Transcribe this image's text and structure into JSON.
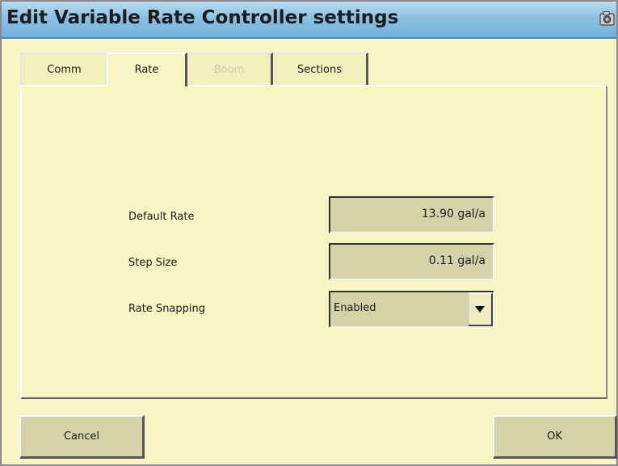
{
  "window": {
    "title": "Edit Variable Rate Controller settings",
    "title_icon": "camera-icon"
  },
  "tabs": [
    {
      "label": "Comm",
      "state": "inactive"
    },
    {
      "label": "Rate",
      "state": "active"
    },
    {
      "label": "Boom",
      "state": "disabled"
    },
    {
      "label": "Sections",
      "state": "inactive"
    }
  ],
  "form": {
    "default_rate": {
      "label": "Default Rate",
      "value": "13.90 gal/a"
    },
    "step_size": {
      "label": "Step Size",
      "value": "0.11 gal/a"
    },
    "rate_snapping": {
      "label": "Rate Snapping",
      "value": "Enabled",
      "icon": "chevron-down-icon"
    }
  },
  "buttons": {
    "cancel": "Cancel",
    "ok": "OK"
  },
  "colors": {
    "background": "#f8f4c4",
    "titlebar": "#8ac0e2",
    "field": "#d6d2a8",
    "disabled_text": "#cdcdb4"
  }
}
